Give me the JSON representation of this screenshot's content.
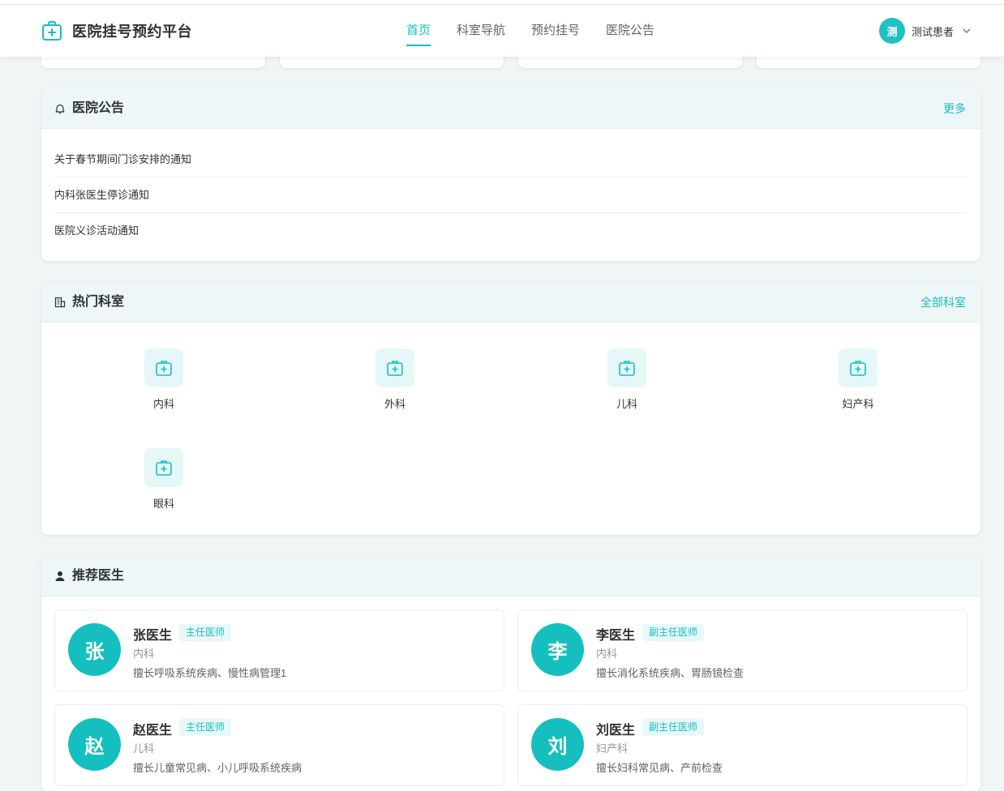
{
  "header": {
    "title": "医院挂号预约平台",
    "nav": [
      "首页",
      "科室导航",
      "预约挂号",
      "医院公告"
    ],
    "active_nav": 0,
    "user": {
      "avatar_text": "测",
      "name": "测试患者"
    },
    "accent": "#16bfbf"
  },
  "notices": {
    "title": "医院公告",
    "more": "更多",
    "items": [
      "关于春节期间门诊安排的通知",
      "内科张医生停诊通知",
      "医院义诊活动通知"
    ]
  },
  "departments": {
    "title": "热门科室",
    "more": "全部科室",
    "items": [
      "内科",
      "外科",
      "儿科",
      "妇产科",
      "眼科"
    ]
  },
  "doctors": {
    "title": "推荐医生",
    "items": [
      {
        "avatar": "张",
        "name": "张医生",
        "level": "主任医师",
        "dept": "内科",
        "desc": "擅长呼吸系统疾病、慢性病管理1"
      },
      {
        "avatar": "李",
        "name": "李医生",
        "level": "副主任医师",
        "dept": "内科",
        "desc": "擅长消化系统疾病、胃肠镜检查"
      },
      {
        "avatar": "赵",
        "name": "赵医生",
        "level": "主任医师",
        "dept": "儿科",
        "desc": "擅长儿童常见病、小儿呼吸系统疾病"
      },
      {
        "avatar": "刘",
        "name": "刘医生",
        "level": "副主任医师",
        "dept": "妇产科",
        "desc": "擅长妇科常见病、产前检查"
      }
    ]
  },
  "icons": {
    "logo": "medical-kit-icon",
    "notice": "bell-icon",
    "department": "building-icon",
    "doctor": "user-icon",
    "dept_item": "medical-kit-icon",
    "dropdown": "chevron-down-icon"
  }
}
